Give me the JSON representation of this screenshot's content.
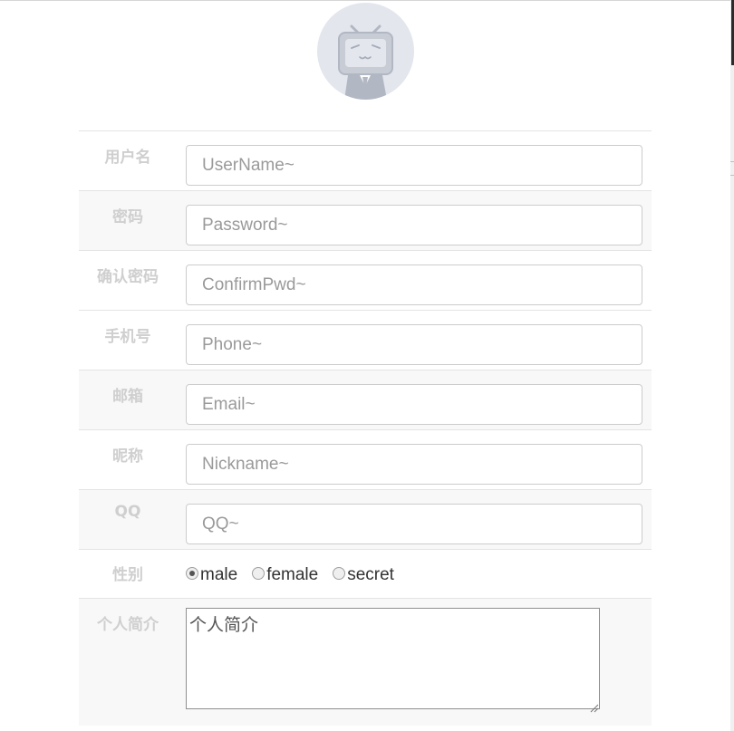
{
  "form": {
    "rows": [
      {
        "label": "用户名",
        "placeholder": "UserName~"
      },
      {
        "label": "密码",
        "placeholder": "Password~"
      },
      {
        "label": "确认密码",
        "placeholder": "ConfirmPwd~"
      },
      {
        "label": "手机号",
        "placeholder": "Phone~"
      },
      {
        "label": "邮箱",
        "placeholder": "Email~"
      },
      {
        "label": "昵称",
        "placeholder": "Nickname~"
      },
      {
        "label": "QQ",
        "placeholder": "QQ~"
      }
    ],
    "gender": {
      "label": "性别",
      "options": [
        "male",
        "female",
        "secret"
      ],
      "selected": "male"
    },
    "bio": {
      "label": "个人简介",
      "value": "个人简介"
    }
  },
  "colors": {
    "label_text": "#cfcfcf",
    "avatar_bg": "#e3e6ed",
    "row_alt_bg": "#f8f8f8"
  }
}
